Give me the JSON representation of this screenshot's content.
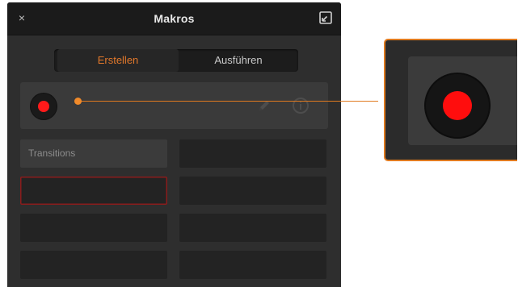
{
  "window": {
    "title": "Makros",
    "close_glyph": "×",
    "close_icon": "close-icon",
    "popout_icon": "popout-window-icon"
  },
  "tabs": [
    {
      "label": "Erstellen",
      "active": true
    },
    {
      "label": "Ausführen",
      "active": false
    }
  ],
  "record_row": {
    "record_icon": "record-icon",
    "edit_icon": "pencil-icon",
    "info_icon": "info-icon"
  },
  "macro_slots": [
    {
      "label": "Transitions",
      "filled": true,
      "selected": false
    },
    {
      "label": "",
      "filled": false,
      "selected": false
    },
    {
      "label": "",
      "filled": false,
      "selected": true
    },
    {
      "label": "",
      "filled": false,
      "selected": false
    },
    {
      "label": "",
      "filled": false,
      "selected": false
    },
    {
      "label": "",
      "filled": false,
      "selected": false
    },
    {
      "label": "",
      "filled": false,
      "selected": false
    },
    {
      "label": "",
      "filled": false,
      "selected": false
    }
  ],
  "colors": {
    "accent": "#e07a1f",
    "record_red": "#ff1a1a",
    "panel_bg": "#2e2e2e",
    "titlebar_bg": "#1b1b1b"
  },
  "callout": {
    "zoomed_icon": "record-icon"
  }
}
